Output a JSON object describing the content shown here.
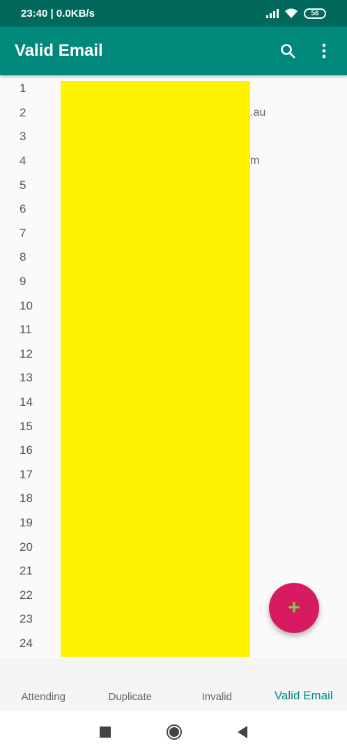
{
  "status_bar": {
    "time_speed": "23:40 | 0.0KB/s",
    "battery": "56"
  },
  "app_bar": {
    "title": "Valid Email",
    "search_icon": "search-icon",
    "menu_icon": "more-vert-icon"
  },
  "rows": [
    {
      "num": "1",
      "email": ""
    },
    {
      "num": "2",
      "email": ".au"
    },
    {
      "num": "3",
      "email": ""
    },
    {
      "num": "4",
      "email": "m"
    },
    {
      "num": "5",
      "email": ""
    },
    {
      "num": "6",
      "email": ""
    },
    {
      "num": "7",
      "email": ""
    },
    {
      "num": "8",
      "email": ""
    },
    {
      "num": "9",
      "email": ""
    },
    {
      "num": "10",
      "email": ""
    },
    {
      "num": "11",
      "email": ""
    },
    {
      "num": "12",
      "email": ""
    },
    {
      "num": "13",
      "email": ""
    },
    {
      "num": "14",
      "email": ""
    },
    {
      "num": "15",
      "email": ""
    },
    {
      "num": "16",
      "email": ""
    },
    {
      "num": "17",
      "email": ""
    },
    {
      "num": "18",
      "email": ""
    },
    {
      "num": "19",
      "email": ""
    },
    {
      "num": "20",
      "email": ""
    },
    {
      "num": "21",
      "email": ""
    },
    {
      "num": "22",
      "email": ""
    },
    {
      "num": "23",
      "email": ""
    },
    {
      "num": "24",
      "email": ""
    }
  ],
  "fab": {
    "label": "+",
    "icon": "add-icon"
  },
  "tabs": [
    {
      "label": "Attending",
      "active": false
    },
    {
      "label": "Duplicate",
      "active": false
    },
    {
      "label": "Invalid",
      "active": false
    },
    {
      "label": "Valid Email",
      "active": true
    }
  ],
  "nav": {
    "recents_icon": "square-icon",
    "home_icon": "circle-icon",
    "back_icon": "triangle-back-icon"
  },
  "colors": {
    "status_bar": "#00695c",
    "app_bar": "#00897b",
    "fab": "#d81b60",
    "fab_glyph": "#8bc34a",
    "redaction": "#fff200",
    "active_tab": "#00897b"
  }
}
